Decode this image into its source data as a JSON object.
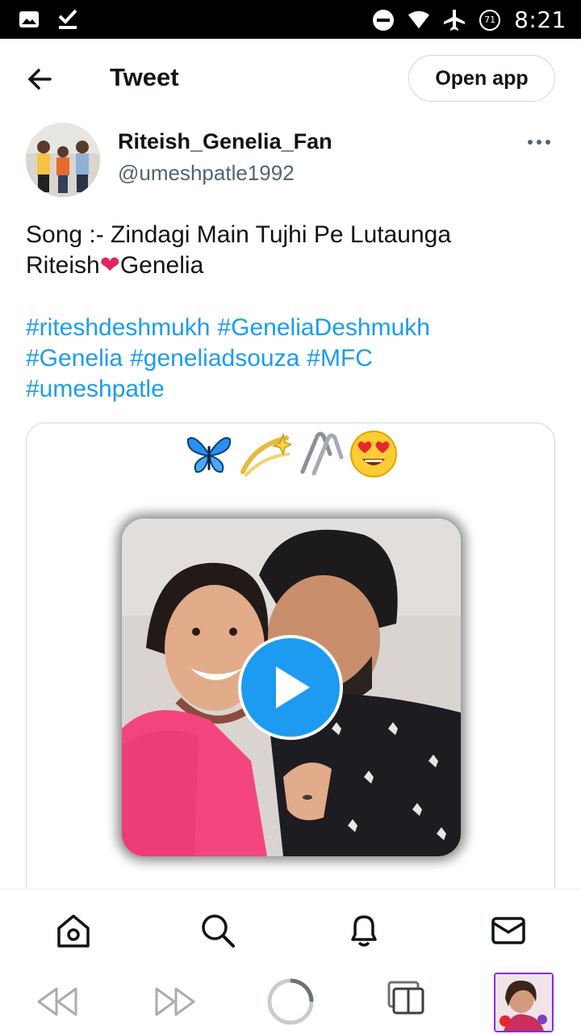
{
  "status_bar": {
    "time": "8:21",
    "battery_level": "71",
    "icons": [
      "gallery-icon",
      "download-done-icon",
      "do-not-disturb-icon",
      "wifi-icon",
      "airplane-icon",
      "battery-icon"
    ]
  },
  "header": {
    "title": "Tweet",
    "open_app_label": "Open app"
  },
  "tweet": {
    "author_name": "Riteish_Genelia_Fan",
    "author_handle": "@umeshpatle1992",
    "text_line1": "Song :- Zindagi Main Tujhi Pe Lutaunga",
    "text_line2_a": "Riteish",
    "text_line2_heart": "❤",
    "text_line2_b": "Genelia",
    "hashtags": [
      "#riteshdeshmukh",
      "#GeneliaDeshmukh",
      "#Genelia",
      "#geneliadsouza",
      "#MFC",
      "#umeshpatle"
    ],
    "media": {
      "type": "video",
      "overlay_emojis": [
        "🦋",
        "💫",
        "🖇",
        "😍"
      ]
    }
  },
  "bottom_nav": {
    "items": [
      "home-icon",
      "search-icon",
      "notifications-icon",
      "messages-icon"
    ]
  },
  "system_nav": {
    "items": [
      "rewind-icon",
      "fast-forward-icon",
      "loading-circle-icon",
      "tabs-icon",
      "profile-thumbnail"
    ]
  },
  "colors": {
    "accent": "#1d9bf0",
    "text": "#0f1419",
    "secondary_text": "#536471",
    "border": "#cfd9de",
    "heart": "#e0245e"
  }
}
